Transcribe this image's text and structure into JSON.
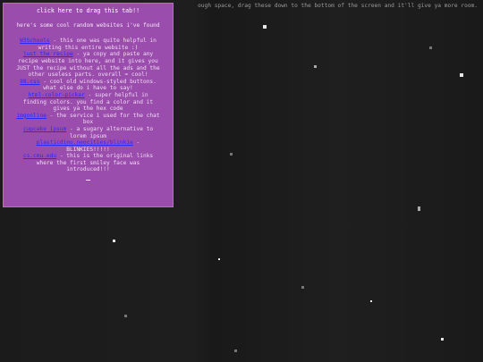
{
  "top_notice": "ough space, drag these down to the bottom of the screen and it'll give ya more room.",
  "panel": {
    "drag_label": "click here to drag this tab!!",
    "intro": "here's some cool random websites i've found",
    "sites": [
      {
        "name": "W3Schools",
        "desc": " - this one was quite helpful in writing this entire website :)"
      },
      {
        "name": "just the recipe",
        "desc": " - ya copy and paste any recipe website into here, and it gives you JUST the recipe without all the ads and the other useless parts. overall = cool!"
      },
      {
        "name": "98.css",
        "desc": " - cool old windows-styled buttons. what else do i have to say!"
      },
      {
        "name": "html-color-picker",
        "desc": " - super helpful in finding colors. you find a color and it gives ya the hex code"
      },
      {
        "name": "imgonline",
        "desc": " - the service i used for the chat box"
      },
      {
        "name": "cupcake ipsum",
        "desc": " - a sugary alternative to lorem ipsum"
      },
      {
        "name": "plasticdino.neocities/blinkie",
        "desc": " - BLINKIES!!!!!"
      },
      {
        "name": "cs.cmu.edu",
        "desc": " - this is the original links where the first smiley face was introduced!!!"
      }
    ]
  }
}
